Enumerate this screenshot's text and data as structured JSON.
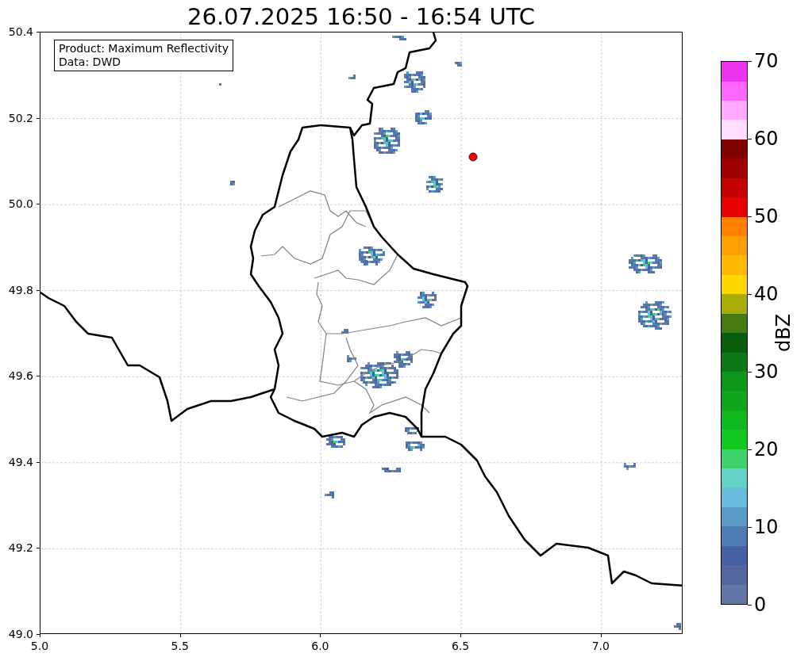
{
  "title": "26.07.2025 16:50 - 16:54 UTC",
  "map": {
    "info_box": [
      "Product: Maximum Reflectivity",
      "Data: DWD"
    ],
    "xticks": [
      "5.0",
      "5.5",
      "6.0",
      "6.5",
      "7.0"
    ],
    "yticks": [
      "50.4",
      "50.2",
      "50.0",
      "49.8",
      "49.6",
      "49.4",
      "49.2",
      "49.0"
    ]
  },
  "colorbar": {
    "label": "dBZ",
    "ticks": [
      "70",
      "60",
      "50",
      "40",
      "30",
      "20",
      "10",
      "0"
    ],
    "bins": [
      {
        "color": "#6276a6"
      },
      {
        "color": "#5567a1"
      },
      {
        "color": "#4462a3"
      },
      {
        "color": "#4d7bb3"
      },
      {
        "color": "#5a9bc8"
      },
      {
        "color": "#68bde0"
      },
      {
        "color": "#62d3c6"
      },
      {
        "color": "#3dd26e"
      },
      {
        "color": "#10c820"
      },
      {
        "color": "#10b81e"
      },
      {
        "color": "#0fa61b"
      },
      {
        "color": "#0d961a"
      },
      {
        "color": "#0b7a16"
      },
      {
        "color": "#08600f"
      },
      {
        "color": "#477a0e"
      },
      {
        "color": "#aaad07"
      },
      {
        "color": "#ffd700"
      },
      {
        "color": "#ffb900"
      },
      {
        "color": "#ff9f00"
      },
      {
        "color": "#ff7f00"
      },
      {
        "color": "#e60000"
      },
      {
        "color": "#c40000"
      },
      {
        "color": "#a00000"
      },
      {
        "color": "#800000"
      },
      {
        "color": "#ffddff"
      },
      {
        "color": "#ffaaff"
      },
      {
        "color": "#ff66ff"
      },
      {
        "color": "#ee33ee"
      }
    ]
  }
}
